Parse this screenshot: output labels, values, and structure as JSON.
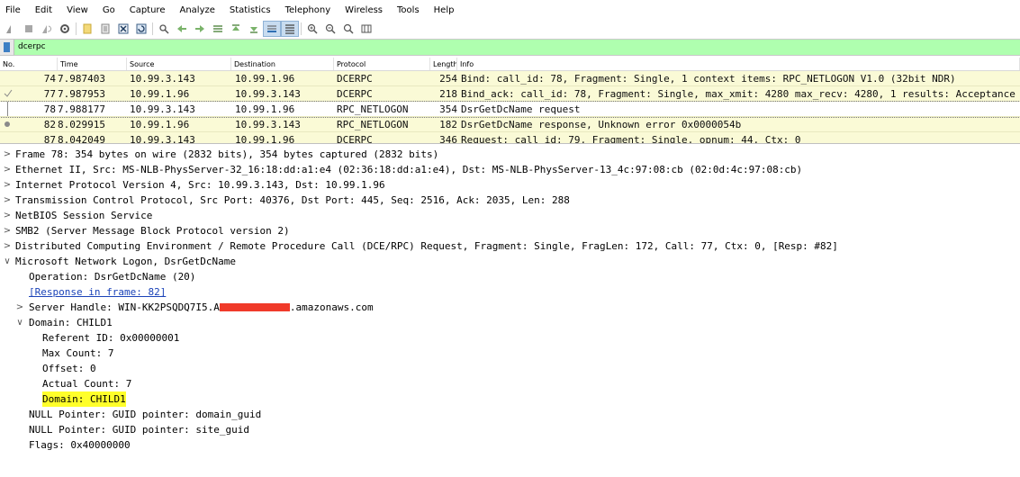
{
  "menu": [
    "File",
    "Edit",
    "View",
    "Go",
    "Capture",
    "Analyze",
    "Statistics",
    "Telephony",
    "Wireless",
    "Tools",
    "Help"
  ],
  "toolbar_icons": [
    "shark-fin-start-icon",
    "stop-capture-icon",
    "restart-capture-icon",
    "capture-options-icon",
    "open-file-icon",
    "save-file-icon",
    "close-file-icon",
    "reload-file-icon",
    "find-packet-icon",
    "go-back-icon",
    "go-forward-icon",
    "go-to-packet-icon",
    "first-packet-icon",
    "last-packet-icon",
    "autoscroll-icon",
    "colorize-icon",
    "zoom-in-icon",
    "zoom-out-icon",
    "normal-size-icon",
    "resize-columns-icon"
  ],
  "filter": {
    "value": "dcerpc"
  },
  "packet_list": {
    "columns": [
      "No.",
      "Time",
      "Source",
      "Destination",
      "Protocol",
      "Length",
      "Info"
    ],
    "rows": [
      {
        "no": "74",
        "time": "7.987403",
        "src": "10.99.3.143",
        "dst": "10.99.1.96",
        "proto": "DCERPC",
        "len": "254",
        "info": "Bind: call_id: 78, Fragment: Single, 1 context items: RPC_NETLOGON V1.0 (32bit NDR)"
      },
      {
        "no": "77",
        "time": "7.987953",
        "src": "10.99.1.96",
        "dst": "10.99.3.143",
        "proto": "DCERPC",
        "len": "218",
        "info": "Bind_ack: call_id: 78, Fragment: Single, max_xmit: 4280 max_recv: 4280, 1 results: Acceptance"
      },
      {
        "no": "78",
        "time": "7.988177",
        "src": "10.99.3.143",
        "dst": "10.99.1.96",
        "proto": "RPC_NETLOGON",
        "len": "354",
        "info": "DsrGetDcName request"
      },
      {
        "no": "82",
        "time": "8.029915",
        "src": "10.99.1.96",
        "dst": "10.99.3.143",
        "proto": "RPC_NETLOGON",
        "len": "182",
        "info": "DsrGetDcName response, Unknown error 0x0000054b"
      },
      {
        "no": "87",
        "time": "8.042049",
        "src": "10.99.3.143",
        "dst": "10.99.1.96",
        "proto": "DCERPC",
        "len": "346",
        "info": "Request: call_id: 79, Fragment: Single, opnum: 44, Ctx: 0"
      }
    ]
  },
  "details": {
    "frame": "Frame 78: 354 bytes on wire (2832 bits), 354 bytes captured (2832 bits)",
    "ethernet": "Ethernet II, Src: MS-NLB-PhysServer-32_16:18:dd:a1:e4 (02:36:18:dd:a1:e4), Dst: MS-NLB-PhysServer-13_4c:97:08:cb (02:0d:4c:97:08:cb)",
    "ip": "Internet Protocol Version 4, Src: 10.99.3.143, Dst: 10.99.1.96",
    "tcp": "Transmission Control Protocol, Src Port: 40376, Dst Port: 445, Seq: 2516, Ack: 2035, Len: 288",
    "netbios": "NetBIOS Session Service",
    "smb2": "SMB2 (Server Message Block Protocol version 2)",
    "dcerpc": "Distributed Computing Environment / Remote Procedure Call (DCE/RPC) Request, Fragment: Single, FragLen: 172, Call: 77, Ctx: 0, [Resp: #82]",
    "netlogon": "Microsoft Network Logon, DsrGetDcName",
    "operation": "Operation: DsrGetDcName (20)",
    "response_link": "[Response in frame: 82]",
    "server_handle_prefix": "Server Handle: WIN-KK2PSQDQ7I5.A",
    "server_handle_suffix": ".amazonaws.com",
    "domain_header": "Domain: CHILD1",
    "referent_id": "Referent ID: 0x00000001",
    "max_count": "Max Count: 7",
    "offset": "Offset: 0",
    "actual_count": "Actual Count: 7",
    "domain_value": "Domain: CHILD1",
    "domain_guid": "NULL Pointer: GUID pointer: domain_guid",
    "site_guid": "NULL Pointer: GUID pointer: site_guid",
    "flags": "Flags: 0x40000000"
  },
  "colors": {
    "filter_bg": "#afffaf",
    "row_bg": "#fafad6",
    "highlight": "#ffff2a",
    "redaction": "#f03a2a"
  }
}
